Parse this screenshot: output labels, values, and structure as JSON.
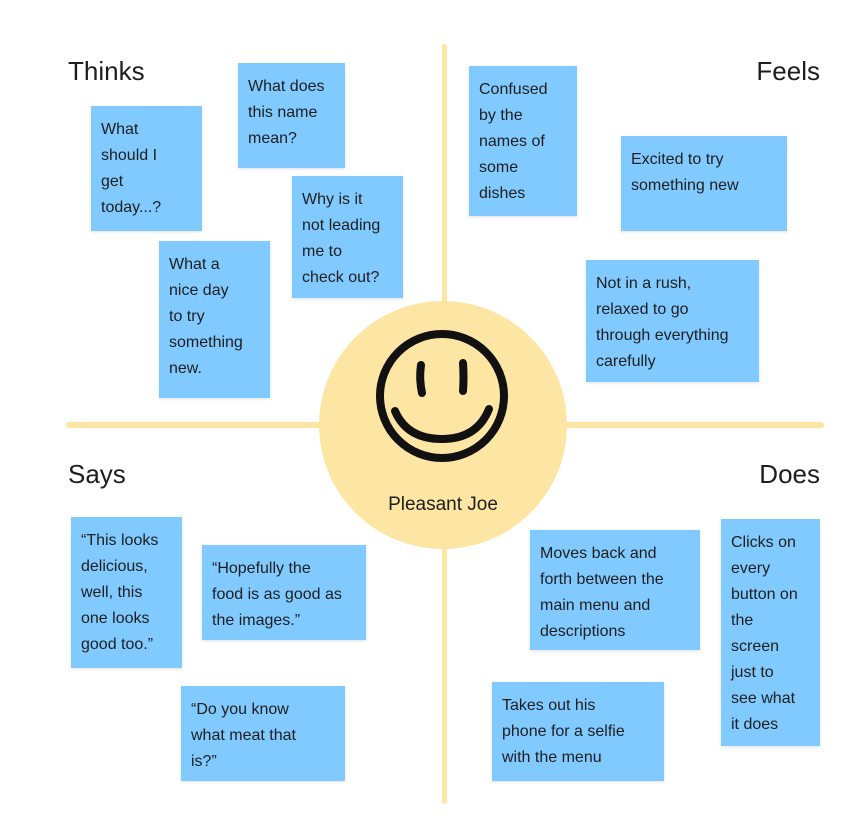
{
  "center": {
    "persona": "Pleasant Joe",
    "icon": "smiley-face-icon"
  },
  "quadrants": {
    "thinks": "Thinks",
    "feels": "Feels",
    "says": "Says",
    "does": "Does"
  },
  "notes": {
    "thinks": [
      "What does\nthis name\nmean?",
      "What\nshould I\nget\ntoday...?",
      "Why is it\nnot leading\nme to\ncheck out?",
      "What a\nnice day\nto try\nsomething\nnew."
    ],
    "feels": [
      "Confused\nby the\nnames of\nsome\ndishes",
      "Excited to try\nsomething new",
      "Not in a rush,\nrelaxed to go\nthrough everything\ncarefully"
    ],
    "says": [
      "“This looks\ndelicious,\nwell, this\none looks\ngood too.”",
      "“Hopefully the\nfood is as good as\nthe images.”",
      "“Do you know\nwhat meat that\nis?”"
    ],
    "does": [
      "Moves back and\nforth between the\nmain menu and\ndescriptions",
      "Clicks on\nevery\nbutton on\nthe\nscreen\njust to\nsee what\nit does",
      "Takes out his\nphone for a selfie\nwith the menu"
    ]
  },
  "colors": {
    "sticky_note": "#80caff",
    "axis": "#fde6a4",
    "center_circle": "#fde6a4",
    "text": "#1e1e1e"
  }
}
